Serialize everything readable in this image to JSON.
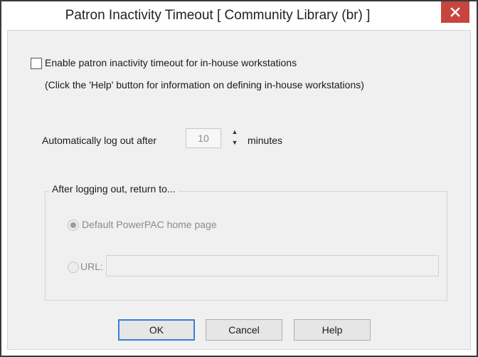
{
  "window": {
    "title": "Patron Inactivity Timeout [ Community Library  (br) ]",
    "close_glyph": "close-icon"
  },
  "enable_checkbox": {
    "label": "Enable patron inactivity timeout for in-house workstations",
    "checked": false
  },
  "help_note": "(Click the 'Help' button for information on defining in-house workstations)",
  "logout": {
    "prefix": "Automatically log out after",
    "value": "10",
    "suffix": "minutes"
  },
  "return_group": {
    "label": "After logging out, return to...",
    "options": [
      {
        "label": "Default PowerPAC home page",
        "selected": true
      },
      {
        "label": "URL:",
        "selected": false
      }
    ],
    "url_value": ""
  },
  "buttons": {
    "ok": "OK",
    "cancel": "Cancel",
    "help": "Help"
  },
  "colors": {
    "close_button": "#c7453f",
    "default_button_border": "#3c7fd3",
    "disabled_text": "#8a8a8a"
  }
}
